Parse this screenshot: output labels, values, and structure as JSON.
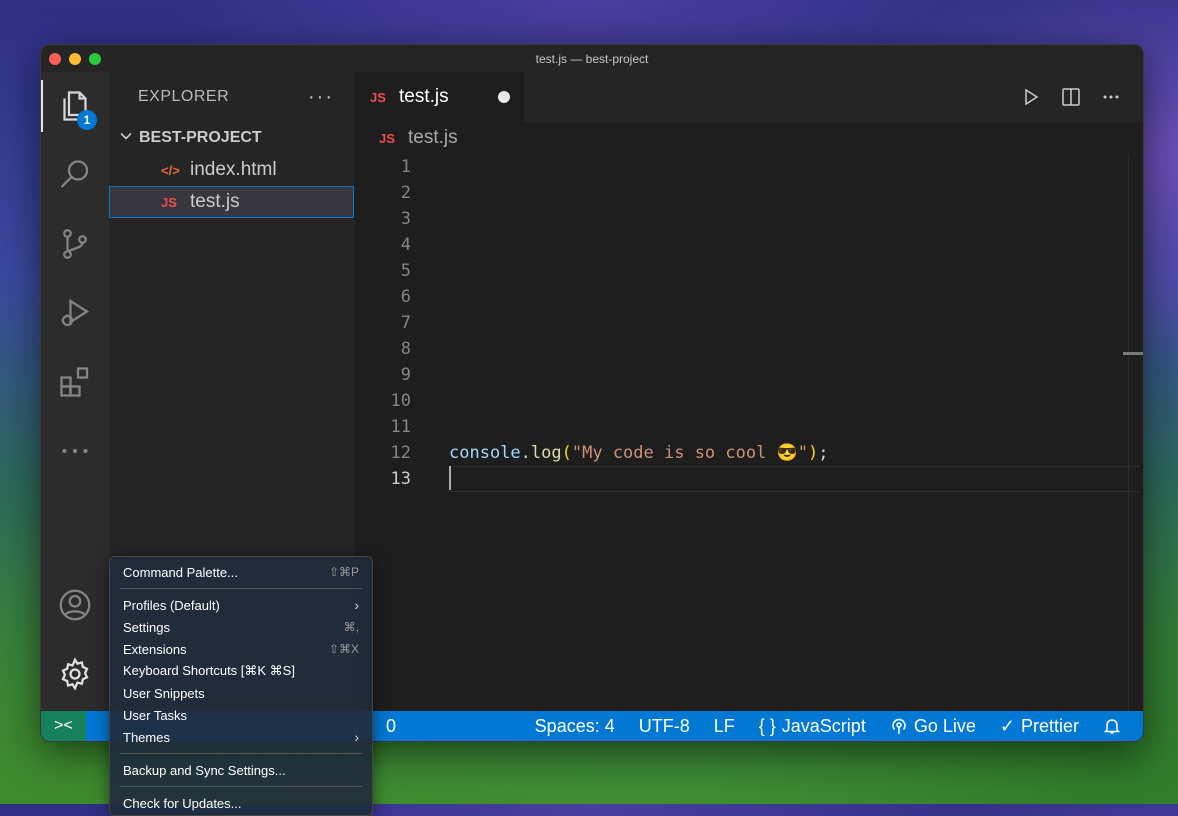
{
  "window": {
    "title": "test.js — best-project"
  },
  "activity_bar": {
    "explorer_badge": "1",
    "items": [
      "explorer-icon",
      "search-icon",
      "source-control-icon",
      "run-debug-icon",
      "extensions-icon",
      "more-icon",
      "account-icon",
      "gear-icon"
    ]
  },
  "explorer": {
    "header": "EXPLORER",
    "more": "···",
    "project": "BEST-PROJECT",
    "files": [
      {
        "name": "index.html",
        "icon": "</>"
      },
      {
        "name": "test.js",
        "icon": "JS"
      }
    ]
  },
  "editor": {
    "tab": {
      "label": "test.js",
      "icon": "JS"
    },
    "breadcrumb": {
      "label": "test.js",
      "icon": "JS"
    },
    "line_numbers": [
      "1",
      "2",
      "3",
      "4",
      "5",
      "6",
      "7",
      "8",
      "9",
      "10",
      "11",
      "12",
      "13"
    ],
    "code": {
      "var": "console",
      "dot": ".",
      "fn": "log",
      "open": "(",
      "str": "\"My code is so cool 😎\"",
      "close": ")",
      "semi": ";"
    }
  },
  "status_bar": {
    "remote_icon": "><",
    "problems": "0",
    "spaces": "Spaces: 4",
    "encoding": "UTF-8",
    "eol": "LF",
    "language": "JavaScript",
    "language_icon": "{ }",
    "go_live": "Go Live",
    "prettier": "Prettier",
    "prettier_icon": "✓"
  },
  "menu": {
    "items": [
      {
        "label": "Command Palette...",
        "shortcut": "⇧⌘P"
      },
      {
        "label": "Profiles (Default)",
        "shortcut": "›"
      },
      {
        "label": "Settings",
        "shortcut": "⌘,"
      },
      {
        "label": "Extensions",
        "shortcut": "⇧⌘X"
      },
      {
        "label": "Keyboard Shortcuts [⌘K ⌘S]",
        "shortcut": ""
      },
      {
        "label": "User Snippets",
        "shortcut": ""
      },
      {
        "label": "User Tasks",
        "shortcut": ""
      },
      {
        "label": "Themes",
        "shortcut": "›"
      },
      {
        "label": "Backup and Sync Settings...",
        "shortcut": ""
      },
      {
        "label": "Check for Updates...",
        "shortcut": ""
      }
    ]
  }
}
